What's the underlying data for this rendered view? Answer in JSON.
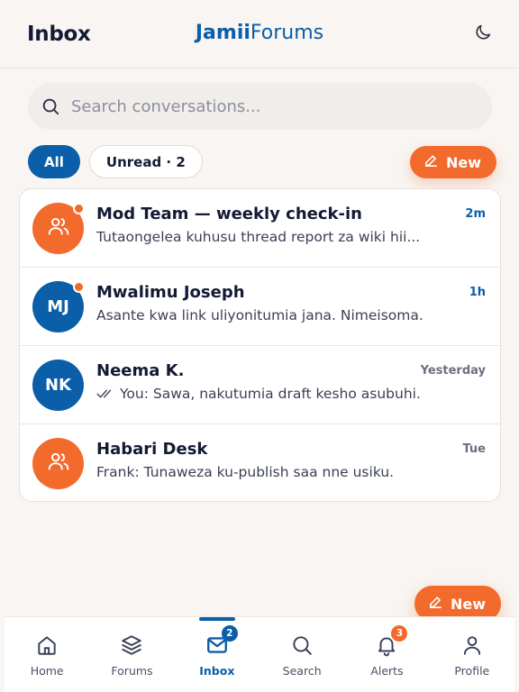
{
  "header": {
    "title": "Inbox",
    "brand_bold": "Jamii",
    "brand_regular": "Forums",
    "theme_icon": "moon-icon"
  },
  "search": {
    "placeholder": "Search conversations...",
    "icon": "search-icon"
  },
  "filters": {
    "all_label": "All",
    "unread_label": "Unread · 2"
  },
  "new_label": "New",
  "conversations": [
    {
      "name": "Mod Team — weekly check-in",
      "time": "2m",
      "preview": "Tutaongelea kuhusu thread report za wiki hii...",
      "avatar": "users-icon",
      "avatar_color": "#f26a2c",
      "unread": true
    },
    {
      "name": "Mwalimu Joseph",
      "time": "1h",
      "preview": "Asante kwa link uliyonitumia jana. Nimeisoma.",
      "initials": "MJ",
      "avatar_color": "#0b5ea8",
      "unread": true
    },
    {
      "name": "Neema K.",
      "time": "Yesterday",
      "preview": "You: Sawa, nakutumia draft kesho asubuhi.",
      "initials": "NK",
      "avatar_color": "#0b5ea8",
      "unread": false,
      "read_receipt": "double-check-icon"
    },
    {
      "name": "Habari Desk",
      "time": "Tue",
      "preview": "Frank: Tunaweza ku-publish saa nne usiku.",
      "avatar": "users-icon",
      "avatar_color": "#f26a2c",
      "unread": false
    }
  ],
  "tabbar": {
    "tabs": [
      {
        "label": "Home",
        "icon": "home-icon"
      },
      {
        "label": "Forums",
        "icon": "layers-icon"
      },
      {
        "label": "Inbox",
        "icon": "mail-icon",
        "badge": "2",
        "active": true
      },
      {
        "label": "Search",
        "icon": "search-icon"
      },
      {
        "label": "Alerts",
        "icon": "bell-icon",
        "badge": "3"
      },
      {
        "label": "Profile",
        "icon": "user-icon"
      }
    ]
  },
  "colors": {
    "brand_blue": "#0b5ea8",
    "accent_orange": "#f26a2c",
    "background": "#f8f5f2"
  }
}
